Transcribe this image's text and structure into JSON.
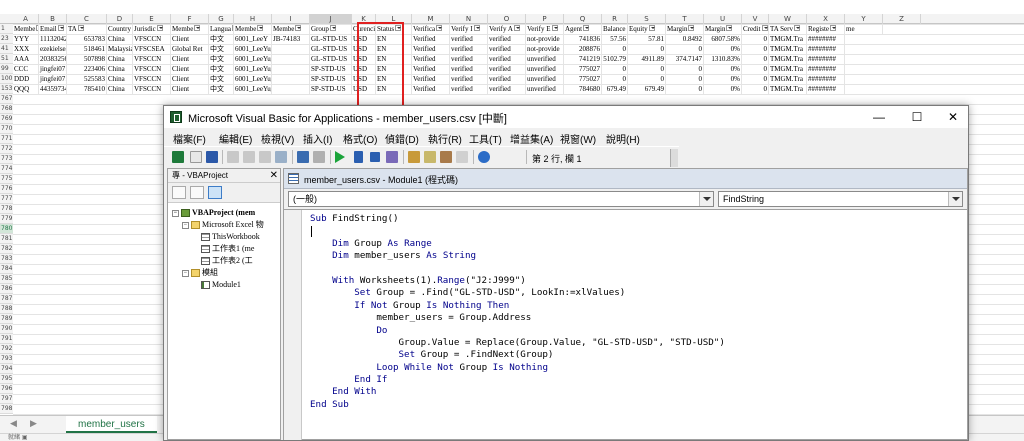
{
  "excel": {
    "columns": [
      "A",
      "B",
      "C",
      "D",
      "E",
      "F",
      "G",
      "H",
      "I",
      "J",
      "K",
      "L",
      "M",
      "N",
      "O",
      "P",
      "Q",
      "R",
      "S",
      "T",
      "U",
      "V",
      "W",
      "X",
      "Y",
      "Z"
    ],
    "header_row": [
      "Membe",
      "Email",
      "TA",
      "Country",
      "Jurisdic",
      "Membe",
      "Langua",
      "Membe",
      "Membe",
      "Group",
      "Curenci",
      "Status",
      "Verifica",
      "Verify I",
      "Verify A",
      "Verify E",
      "Agent",
      "Balance",
      "Equity",
      "Margin",
      "Margin",
      "Credit",
      "TA Serv",
      "Registe",
      "me"
    ],
    "rows": [
      {
        "num": "23",
        "cells": [
          "YYY",
          "111320429",
          "653783",
          "China",
          "VFSCCN",
          "Client",
          "中文",
          "6001_LeeY",
          "JB-74183",
          "GL-STD-US",
          "USD",
          "EN",
          "Verified",
          "verified",
          "verified",
          "not-provide",
          "741836",
          "57.56",
          "57.81",
          "0.8492",
          "6807.58%",
          "0",
          "TMGM.Tra",
          "########"
        ]
      },
      {
        "num": "41",
        "cells": [
          "XXX",
          "ezekielsea",
          "518461",
          "Malaysia",
          "VFSCSEA",
          "Global Ret",
          "中文",
          "6001_LeeYu_Gold",
          "",
          "GL-STD-US",
          "USD",
          "EN",
          "Verified",
          "verified",
          "verified",
          "not-provide",
          "208876",
          "0",
          "0",
          "0",
          "0%",
          "0",
          "TMGM.Tra",
          "########"
        ]
      },
      {
        "num": "51",
        "cells": [
          "AAA",
          "20383256",
          "507898",
          "China",
          "VFSCCN",
          "Client",
          "中文",
          "6001_LeeYu_Gold",
          "",
          "GL-STD-US",
          "USD",
          "EN",
          "Verified",
          "verified",
          "verified",
          "unverified",
          "741219",
          "5102.79",
          "4911.89",
          "374.7147",
          "1310.83%",
          "0",
          "TMGM.Tra",
          "########"
        ]
      },
      {
        "num": "99",
        "cells": [
          "CCC",
          "jingfei0715",
          "223406",
          "China",
          "VFSCCN",
          "Client",
          "中文",
          "6001_LeeYu_Gold",
          "",
          "SP-STD-US",
          "USD",
          "EN",
          "Verified",
          "verified",
          "verified",
          "unverified",
          "775027",
          "0",
          "0",
          "0",
          "0%",
          "0",
          "TMGM.Tra",
          "########"
        ]
      },
      {
        "num": "100",
        "cells": [
          "DDD",
          "jingfei0715",
          "525583",
          "China",
          "VFSCCN",
          "Client",
          "中文",
          "6001_LeeYu_Gold",
          "",
          "SP-STD-US",
          "USD",
          "EN",
          "Verified",
          "verified",
          "verified",
          "unverified",
          "775027",
          "0",
          "0",
          "0",
          "0%",
          "0",
          "TMGM.Tra",
          "########"
        ]
      },
      {
        "num": "153",
        "cells": [
          "QQQ",
          "443597347",
          "785410",
          "China",
          "VFSCCN",
          "Client",
          "中文",
          "6001_LeeYu_Gold",
          "",
          "SP-STD-US",
          "USD",
          "EN",
          "Verified",
          "verified",
          "verified",
          "unverified",
          "784680",
          "679.49",
          "679.49",
          "0",
          "0%",
          "0",
          "TMGM.Tra",
          "########"
        ]
      }
    ],
    "empty_row_numbers": [
      "767",
      "768",
      "769",
      "770",
      "771",
      "772",
      "773",
      "774",
      "775",
      "776",
      "777",
      "778",
      "779",
      "780",
      "781",
      "782",
      "783",
      "784",
      "785",
      "786",
      "787",
      "788",
      "789",
      "790",
      "791",
      "792",
      "793",
      "794",
      "795",
      "796",
      "797",
      "798",
      "799",
      "800",
      "801",
      "802",
      "803",
      "804",
      "805",
      "806",
      "807",
      "808",
      "809"
    ],
    "selected_row": "780",
    "sheet_tab": "member_users",
    "status_text": "就緒  ▣"
  },
  "vba": {
    "title": "Microsoft Visual Basic for Applications - member_users.csv [中斷]",
    "window_controls": {
      "minimize": "—",
      "maximize": "☐",
      "close": "✕"
    },
    "menu": [
      "檔案(F)",
      "編輯(E)",
      "檢視(V)",
      "插入(I)",
      "格式(O)",
      "偵錯(D)",
      "執行(R)",
      "工具(T)",
      "增益集(A)",
      "視窗(W)",
      "說明(H)"
    ],
    "toolbar_position": "第 2 行, 欄 1",
    "project": {
      "title": "專 - VBAProject",
      "close": "✕",
      "tree": [
        {
          "label": "VBAProject (mem",
          "indent": 0,
          "icon": "project",
          "toggle": "−",
          "bold": true
        },
        {
          "label": "Microsoft Excel 物",
          "indent": 1,
          "icon": "folder",
          "toggle": "−",
          "bold": false
        },
        {
          "label": "ThisWorkbook",
          "indent": 2,
          "icon": "sheet",
          "toggle": "",
          "bold": false
        },
        {
          "label": "工作表1 (me",
          "indent": 2,
          "icon": "sheet",
          "toggle": "",
          "bold": false
        },
        {
          "label": "工作表2 (工",
          "indent": 2,
          "icon": "sheet",
          "toggle": "",
          "bold": false
        },
        {
          "label": "模組",
          "indent": 1,
          "icon": "folder",
          "toggle": "−",
          "bold": false
        },
        {
          "label": "Module1",
          "indent": 2,
          "icon": "module",
          "toggle": "",
          "bold": false
        }
      ]
    },
    "code_window": {
      "title": "member_users.csv - Module1 (程式碼)",
      "object_combo": "(一般)",
      "procedure_combo": "FindString",
      "lines": [
        "Sub FindString()",
        "",
        "    Dim Group As Range",
        "    Dim member_users As String",
        "",
        "    With Worksheets(1).Range(\"J2:J999\")",
        "        Set Group = .Find(\"GL-STD-USD\", LookIn:=xlValues)",
        "        If Not Group Is Nothing Then",
        "            member_users = Group.Address",
        "            Do",
        "                Group.Value = Replace(Group.Value, \"GL-STD-USD\", \"STD-USD\")",
        "                Set Group = .FindNext(Group)",
        "            Loop While Not Group Is Nothing",
        "        End If",
        "    End With",
        "End Sub"
      ]
    }
  }
}
